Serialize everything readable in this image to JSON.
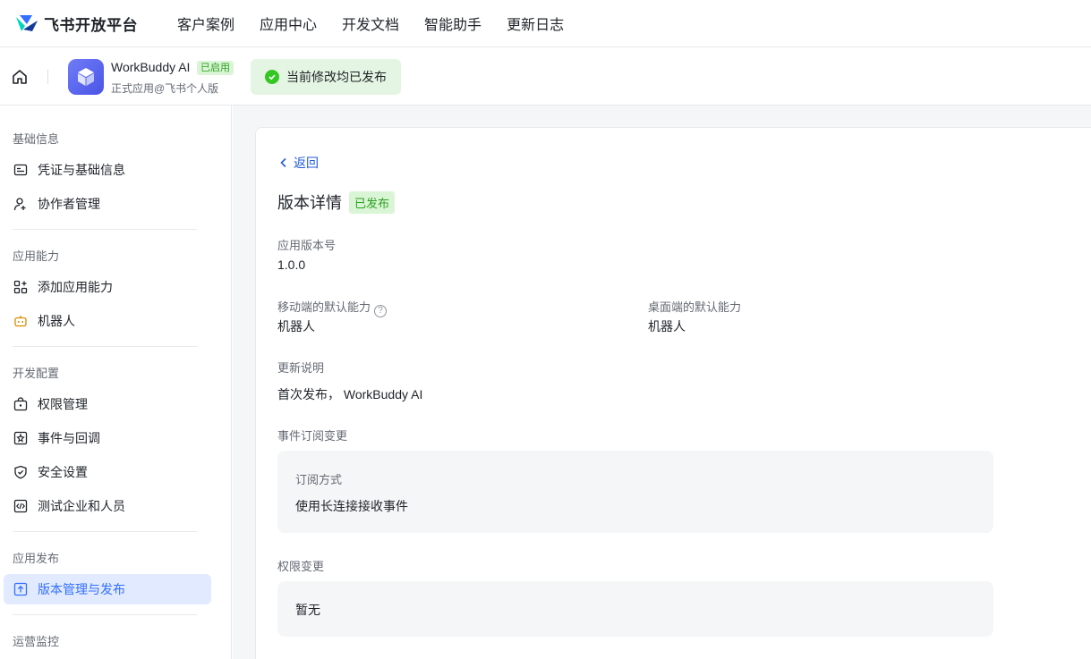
{
  "topnav": {
    "brand": "飞书开放平台",
    "items": [
      "客户案例",
      "应用中心",
      "开发文档",
      "智能助手",
      "更新日志"
    ]
  },
  "appbar": {
    "app_name": "WorkBuddy AI",
    "app_status": "已启用",
    "app_subtitle": "正式应用@飞书个人版",
    "toast": "当前修改均已发布"
  },
  "sidebar": {
    "sections": [
      {
        "title": "基础信息",
        "items": [
          {
            "label": "凭证与基础信息",
            "icon": "credential-icon"
          },
          {
            "label": "协作者管理",
            "icon": "add-person-icon"
          }
        ]
      },
      {
        "title": "应用能力",
        "items": [
          {
            "label": "添加应用能力",
            "icon": "apps-add-icon"
          },
          {
            "label": "机器人",
            "icon": "robot-icon"
          }
        ]
      },
      {
        "title": "开发配置",
        "items": [
          {
            "label": "权限管理",
            "icon": "lock-box-icon"
          },
          {
            "label": "事件与回调",
            "icon": "event-icon"
          },
          {
            "label": "安全设置",
            "icon": "shield-icon"
          },
          {
            "label": "测试企业和人员",
            "icon": "code-box-icon"
          }
        ]
      },
      {
        "title": "应用发布",
        "items": [
          {
            "label": "版本管理与发布",
            "icon": "upload-icon",
            "active": true
          }
        ]
      },
      {
        "title": "运营监控",
        "items": []
      }
    ]
  },
  "main": {
    "back": "返回",
    "title": "版本详情",
    "title_badge": "已发布",
    "version_label": "应用版本号",
    "version_value": "1.0.0",
    "mobile_label": "移动端的默认能力",
    "mobile_value": "机器人",
    "desktop_label": "桌面端的默认能力",
    "desktop_value": "机器人",
    "notes_label": "更新说明",
    "notes_value": "首次发布， WorkBuddy AI",
    "event_label": "事件订阅变更",
    "event_box_label": "订阅方式",
    "event_box_value": "使用长连接接收事件",
    "perm_label": "权限变更",
    "perm_box_value": "暂无"
  },
  "colors": {
    "accent": "#3370ff",
    "success": "#34c724",
    "active_bg": "#e1eaff"
  }
}
